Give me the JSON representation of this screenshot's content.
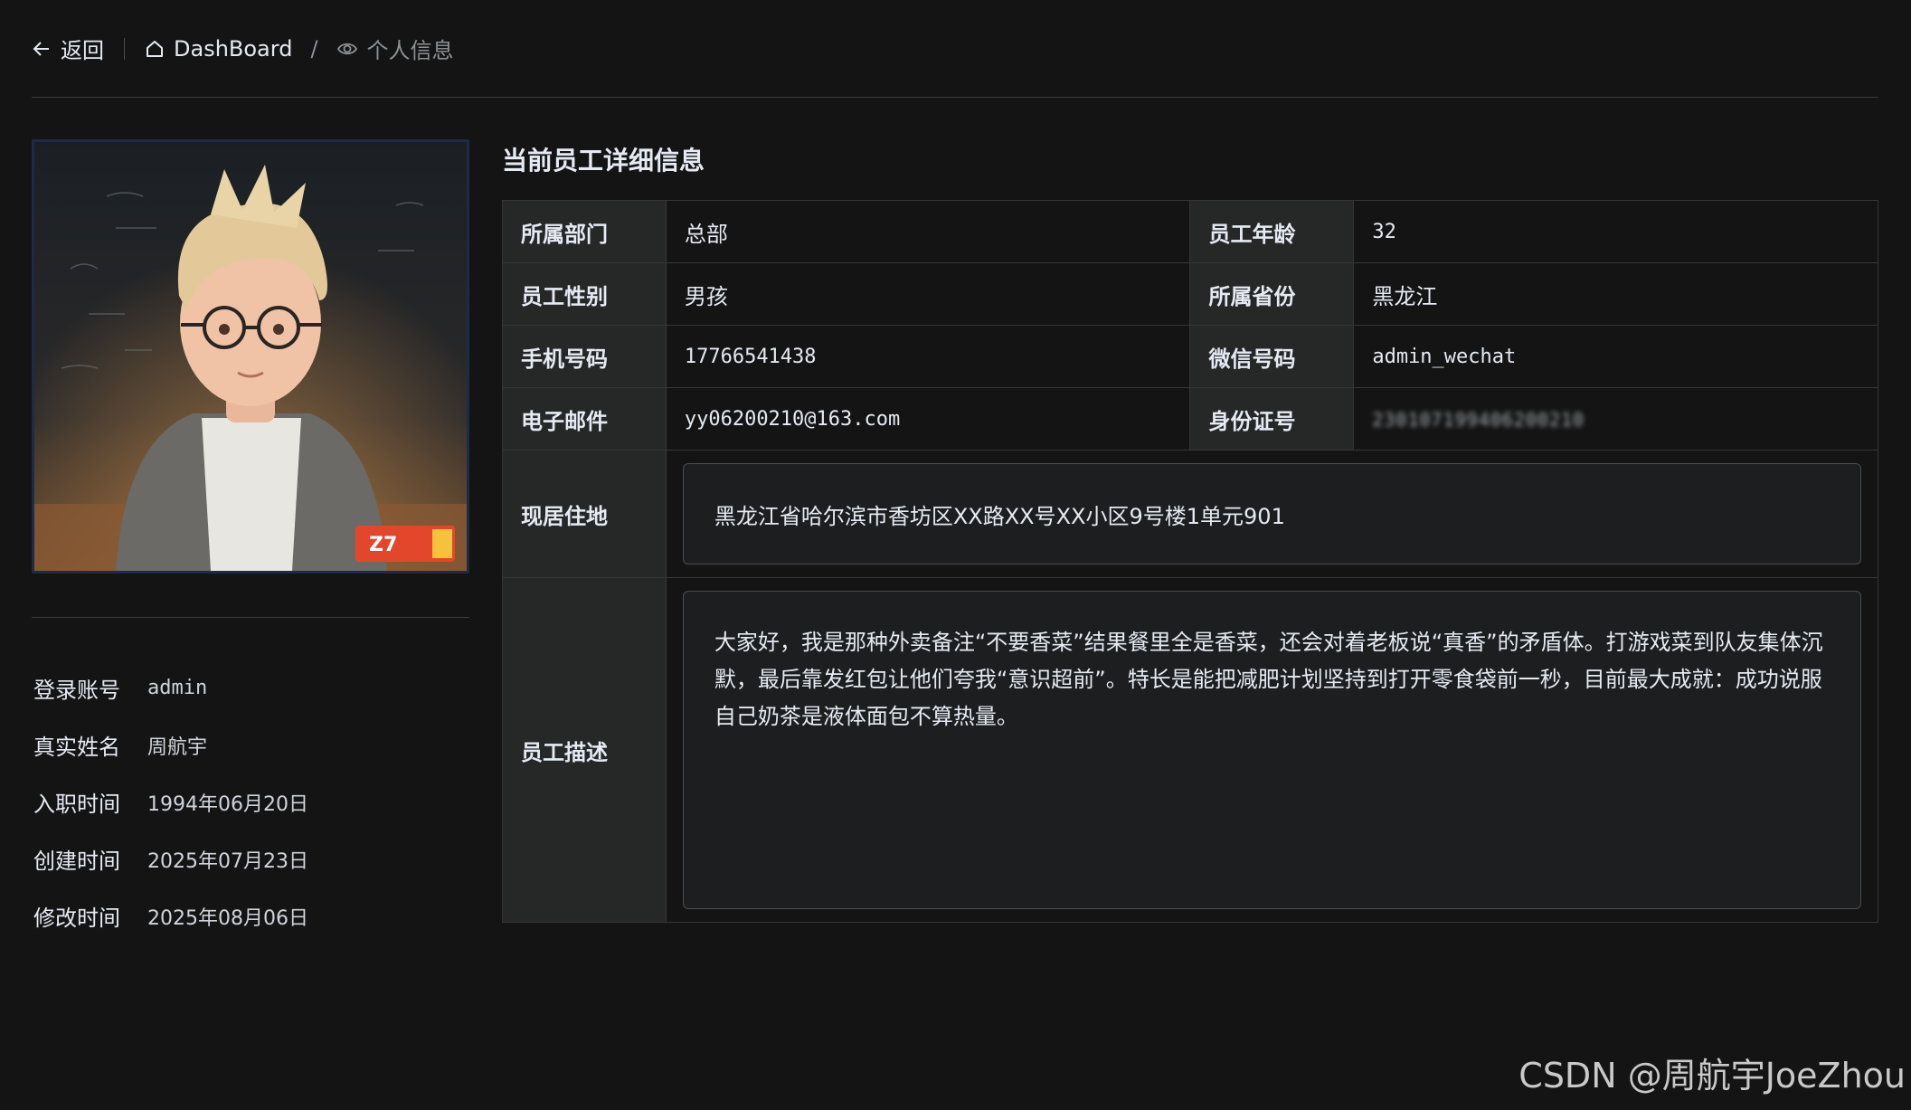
{
  "header": {
    "back_label": "返回",
    "breadcrumbs": [
      {
        "label": "DashBoard",
        "icon": "home-icon"
      },
      {
        "label": "个人信息",
        "icon": "eye-icon"
      }
    ],
    "separator": "/"
  },
  "profile": {
    "rows": [
      {
        "label": "登录账号",
        "value": "admin"
      },
      {
        "label": "真实姓名",
        "value": "周航宇"
      },
      {
        "label": "入职时间",
        "value": "1994年06月20日"
      },
      {
        "label": "创建时间",
        "value": "2025年07月23日"
      },
      {
        "label": "修改时间",
        "value": "2025年08月06日"
      }
    ]
  },
  "details": {
    "title": "当前员工详细信息",
    "department_label": "所属部门",
    "department": "总部",
    "age_label": "员工年龄",
    "age": "32",
    "gender_label": "员工性别",
    "gender": "男孩",
    "province_label": "所属省份",
    "province": "黑龙江",
    "phone_label": "手机号码",
    "phone": "17766541438",
    "wechat_label": "微信号码",
    "wechat": "admin_wechat",
    "email_label": "电子邮件",
    "email": "yy06200210@163.com",
    "idcard_label": "身份证号",
    "idcard": "230107199406200210",
    "address_label": "现居住地",
    "address": "黑龙江省哈尔滨市香坊区XX路XX号XX小区9号楼1单元901",
    "description_label": "员工描述",
    "description": "大家好，我是那种外卖备注“不要香菜”结果餐里全是香菜，还会对着老板说“真香”的矛盾体。打游戏菜到队友集体沉默，最后靠发红包让他们夸我“意识超前”。特长是能把减肥计划坚持到打开零食袋前一秒，目前最大成就：成功说服自己奶茶是液体面包不算热量。"
  },
  "watermark": "CSDN @周航宇JoeZhou"
}
